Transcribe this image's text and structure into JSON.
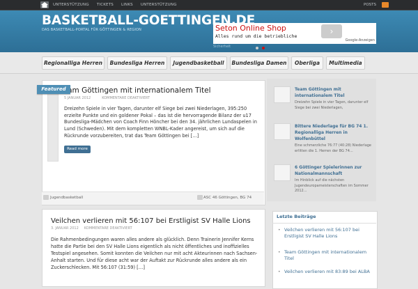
{
  "topbar": {
    "nav": [
      "UNTERSTÜTZUNG",
      "TICKETS",
      "LINKS",
      "UNTERSTÜTZUNG"
    ],
    "right": "POSTS"
  },
  "header": {
    "logo": "BASKETBALL-GOETTINGEN.DE",
    "tagline": "DAS BASKETBALL-PORTAL FÜR GÖTTINGEN & REGION"
  },
  "ad": {
    "title": "Seton Online Shop",
    "text": "Alles rund um die betriebliche",
    "google": "Google-Anzeigen",
    "sub": "Sicherheit"
  },
  "mainnav": [
    "Regionalliga Herren",
    "Bundesliga Herren",
    "Jugendbasketball",
    "Bundesliga Damen",
    "Oberliga",
    "Multimedia"
  ],
  "featured_post": {
    "badge": "Featured",
    "title": "Team Göttingen mit internationalem Titel",
    "date": "5 JANUAR 2012",
    "comments": "KOMMENTARE DEAKTIVIERT",
    "excerpt": "Dreizehn Spiele in vier Tagen, darunter elf Siege bei zwei Niederlagen, 395:250 erzielte Punkte und ein goldener Pokal – das ist die hervorragende Bilanz der u17 Bundesliga-Mädchen von Coach Finn Höncher bei den 34. jährlichen Lundaspelen in Lund (Schweden). Mit dem kompletten WNBL-Kader angereist, um sich auf die Rückrunde vorzubereiten, trat das Team Göttingen bei […]",
    "readmore": "Read more",
    "category": "Jugendbasketball",
    "tags": "ASC 46 Göttingen, BG 74"
  },
  "sidebar_featured": [
    {
      "title": "Team Göttingen mit internationalem Titel",
      "text": "Dreizehn Spiele in vier Tagen, darunter elf Siege bei zwei Niederlagen,"
    },
    {
      "title": "Bittere Niederlage für BG 74 1. Regionalliga Herren in Wolfenbüttel",
      "text": "Eine schmerzliche 76:77 (40:28) Niederlage erlitten die 1. Herren der BG 74..."
    },
    {
      "title": "6 Göttinger Spielerinnen zur Nationalmannschaft",
      "text": "Im Hinblick auf die nächsten Jugendeuropameisterschaften im Sommer 2012..."
    }
  ],
  "second_post": {
    "title": "Veilchen verlieren mit 56:107 bei Erstligist SV Halle Lions",
    "date": "3. JANUAR 2012",
    "comments": "KOMMENTARE DEAKTIVIERT",
    "excerpt": "Die Rahmenbedingungen waren alles andere als glücklich. Denn Trainerin Jennifer Kerns hatte die Partie bei den SV Halle Lions eigentlich als nicht öffentliches und inoffizielles Testspiel angesehen. Somit konnten die Veilchen nur mit acht Akteurinnen nach Sachsen-Anhalt starten. Und für diese acht war der Auftakt zur Rückrunde alles andere als ein Zuckerschlecken. Mit 56:107 (31:59) […]"
  },
  "latest": {
    "heading": "Letzte Beiträge",
    "items": [
      "Veilchen verlieren mit 56:107 bei Erstligist SV Halle Lions",
      "Team Göttingen mit internationalem Titel",
      "Veilchen verlieren mit 83:89 bei ALBA"
    ]
  },
  "colors": {
    "header": "#3d8ab4",
    "accent": "#3f6f93",
    "badge": "#4f8fb5"
  }
}
